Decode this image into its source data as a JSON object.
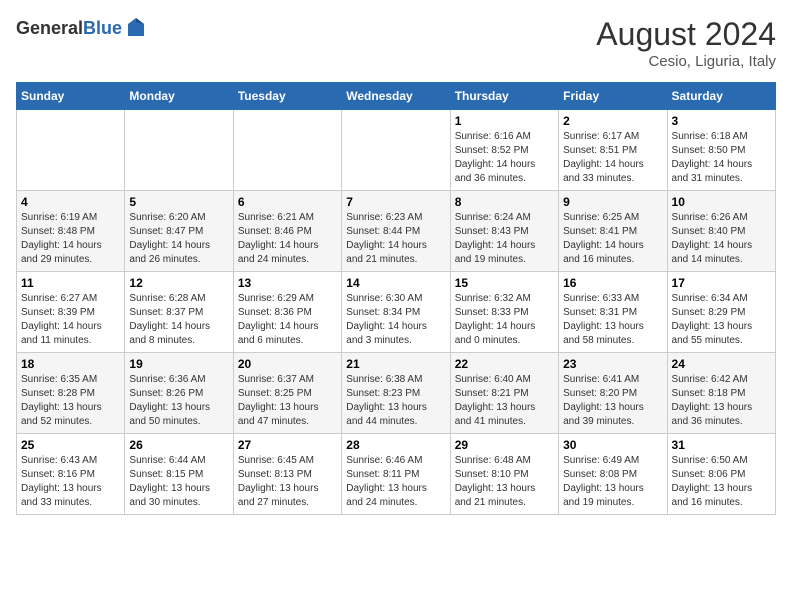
{
  "header": {
    "logo_general": "General",
    "logo_blue": "Blue",
    "month_year": "August 2024",
    "location": "Cesio, Liguria, Italy"
  },
  "days_of_week": [
    "Sunday",
    "Monday",
    "Tuesday",
    "Wednesday",
    "Thursday",
    "Friday",
    "Saturday"
  ],
  "weeks": [
    [
      {
        "day": "",
        "info": ""
      },
      {
        "day": "",
        "info": ""
      },
      {
        "day": "",
        "info": ""
      },
      {
        "day": "",
        "info": ""
      },
      {
        "day": "1",
        "info": "Sunrise: 6:16 AM\nSunset: 8:52 PM\nDaylight: 14 hours\nand 36 minutes."
      },
      {
        "day": "2",
        "info": "Sunrise: 6:17 AM\nSunset: 8:51 PM\nDaylight: 14 hours\nand 33 minutes."
      },
      {
        "day": "3",
        "info": "Sunrise: 6:18 AM\nSunset: 8:50 PM\nDaylight: 14 hours\nand 31 minutes."
      }
    ],
    [
      {
        "day": "4",
        "info": "Sunrise: 6:19 AM\nSunset: 8:48 PM\nDaylight: 14 hours\nand 29 minutes."
      },
      {
        "day": "5",
        "info": "Sunrise: 6:20 AM\nSunset: 8:47 PM\nDaylight: 14 hours\nand 26 minutes."
      },
      {
        "day": "6",
        "info": "Sunrise: 6:21 AM\nSunset: 8:46 PM\nDaylight: 14 hours\nand 24 minutes."
      },
      {
        "day": "7",
        "info": "Sunrise: 6:23 AM\nSunset: 8:44 PM\nDaylight: 14 hours\nand 21 minutes."
      },
      {
        "day": "8",
        "info": "Sunrise: 6:24 AM\nSunset: 8:43 PM\nDaylight: 14 hours\nand 19 minutes."
      },
      {
        "day": "9",
        "info": "Sunrise: 6:25 AM\nSunset: 8:41 PM\nDaylight: 14 hours\nand 16 minutes."
      },
      {
        "day": "10",
        "info": "Sunrise: 6:26 AM\nSunset: 8:40 PM\nDaylight: 14 hours\nand 14 minutes."
      }
    ],
    [
      {
        "day": "11",
        "info": "Sunrise: 6:27 AM\nSunset: 8:39 PM\nDaylight: 14 hours\nand 11 minutes."
      },
      {
        "day": "12",
        "info": "Sunrise: 6:28 AM\nSunset: 8:37 PM\nDaylight: 14 hours\nand 8 minutes."
      },
      {
        "day": "13",
        "info": "Sunrise: 6:29 AM\nSunset: 8:36 PM\nDaylight: 14 hours\nand 6 minutes."
      },
      {
        "day": "14",
        "info": "Sunrise: 6:30 AM\nSunset: 8:34 PM\nDaylight: 14 hours\nand 3 minutes."
      },
      {
        "day": "15",
        "info": "Sunrise: 6:32 AM\nSunset: 8:33 PM\nDaylight: 14 hours\nand 0 minutes."
      },
      {
        "day": "16",
        "info": "Sunrise: 6:33 AM\nSunset: 8:31 PM\nDaylight: 13 hours\nand 58 minutes."
      },
      {
        "day": "17",
        "info": "Sunrise: 6:34 AM\nSunset: 8:29 PM\nDaylight: 13 hours\nand 55 minutes."
      }
    ],
    [
      {
        "day": "18",
        "info": "Sunrise: 6:35 AM\nSunset: 8:28 PM\nDaylight: 13 hours\nand 52 minutes."
      },
      {
        "day": "19",
        "info": "Sunrise: 6:36 AM\nSunset: 8:26 PM\nDaylight: 13 hours\nand 50 minutes."
      },
      {
        "day": "20",
        "info": "Sunrise: 6:37 AM\nSunset: 8:25 PM\nDaylight: 13 hours\nand 47 minutes."
      },
      {
        "day": "21",
        "info": "Sunrise: 6:38 AM\nSunset: 8:23 PM\nDaylight: 13 hours\nand 44 minutes."
      },
      {
        "day": "22",
        "info": "Sunrise: 6:40 AM\nSunset: 8:21 PM\nDaylight: 13 hours\nand 41 minutes."
      },
      {
        "day": "23",
        "info": "Sunrise: 6:41 AM\nSunset: 8:20 PM\nDaylight: 13 hours\nand 39 minutes."
      },
      {
        "day": "24",
        "info": "Sunrise: 6:42 AM\nSunset: 8:18 PM\nDaylight: 13 hours\nand 36 minutes."
      }
    ],
    [
      {
        "day": "25",
        "info": "Sunrise: 6:43 AM\nSunset: 8:16 PM\nDaylight: 13 hours\nand 33 minutes."
      },
      {
        "day": "26",
        "info": "Sunrise: 6:44 AM\nSunset: 8:15 PM\nDaylight: 13 hours\nand 30 minutes."
      },
      {
        "day": "27",
        "info": "Sunrise: 6:45 AM\nSunset: 8:13 PM\nDaylight: 13 hours\nand 27 minutes."
      },
      {
        "day": "28",
        "info": "Sunrise: 6:46 AM\nSunset: 8:11 PM\nDaylight: 13 hours\nand 24 minutes."
      },
      {
        "day": "29",
        "info": "Sunrise: 6:48 AM\nSunset: 8:10 PM\nDaylight: 13 hours\nand 21 minutes."
      },
      {
        "day": "30",
        "info": "Sunrise: 6:49 AM\nSunset: 8:08 PM\nDaylight: 13 hours\nand 19 minutes."
      },
      {
        "day": "31",
        "info": "Sunrise: 6:50 AM\nSunset: 8:06 PM\nDaylight: 13 hours\nand 16 minutes."
      }
    ]
  ]
}
